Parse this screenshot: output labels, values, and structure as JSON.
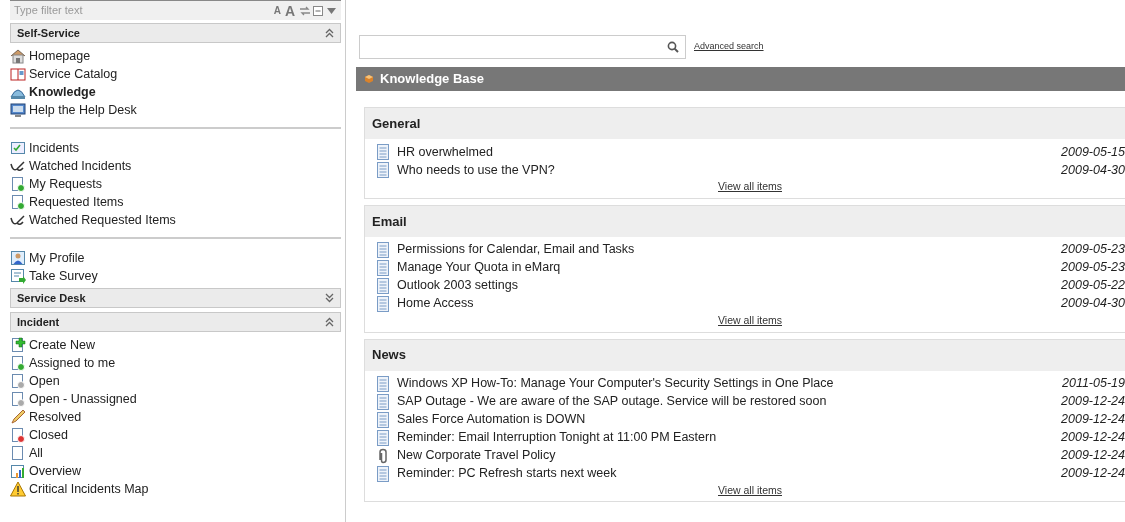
{
  "filter": {
    "placeholder": "Type filter text",
    "tools": [
      "A",
      "A"
    ]
  },
  "sections": [
    {
      "title": "Self-Service",
      "expanded": true,
      "groups": [
        [
          {
            "label": "Homepage",
            "selected": false
          },
          {
            "label": "Service Catalog",
            "selected": false
          },
          {
            "label": "Knowledge",
            "selected": true
          },
          {
            "label": "Help the Help Desk",
            "selected": false
          }
        ],
        [
          {
            "label": "Incidents",
            "selected": false
          },
          {
            "label": "Watched Incidents",
            "selected": false
          },
          {
            "label": "My Requests",
            "selected": false
          },
          {
            "label": "Requested Items",
            "selected": false
          },
          {
            "label": "Watched Requested Items",
            "selected": false
          }
        ],
        [
          {
            "label": "My Profile",
            "selected": false
          },
          {
            "label": "Take Survey",
            "selected": false
          }
        ]
      ]
    },
    {
      "title": "Service Desk",
      "expanded": false
    },
    {
      "title": "Incident",
      "expanded": true,
      "groups": [
        [
          {
            "label": "Create New",
            "selected": false
          },
          {
            "label": "Assigned to me",
            "selected": false
          },
          {
            "label": "Open",
            "selected": false
          },
          {
            "label": "Open - Unassigned",
            "selected": false
          },
          {
            "label": "Resolved",
            "selected": false
          },
          {
            "label": "Closed",
            "selected": false
          },
          {
            "label": "All",
            "selected": false
          },
          {
            "label": "Overview",
            "selected": false
          },
          {
            "label": "Critical Incidents Map",
            "selected": false
          }
        ]
      ]
    }
  ],
  "search": {
    "link": "Advanced search"
  },
  "knowledge_base": {
    "title": "Knowledge Base",
    "categories": [
      {
        "title": "General",
        "view_all": "View all items",
        "articles": [
          {
            "title": "HR overwhelmed",
            "date": "2009-05-15",
            "kind": "document"
          },
          {
            "title": "Who needs to use the VPN?",
            "date": "2009-04-30",
            "kind": "document"
          }
        ]
      },
      {
        "title": "Email",
        "view_all": "View all items",
        "articles": [
          {
            "title": "Permissions for Calendar, Email and Tasks",
            "date": "2009-05-23",
            "kind": "document"
          },
          {
            "title": "Manage Your Quota in eMarq",
            "date": "2009-05-23",
            "kind": "document"
          },
          {
            "title": "Outlook 2003 settings",
            "date": "2009-05-22",
            "kind": "document"
          },
          {
            "title": "Home Access",
            "date": "2009-04-30",
            "kind": "document"
          }
        ]
      },
      {
        "title": "News",
        "view_all": "View all items",
        "articles": [
          {
            "title": "Windows XP How-To: Manage Your Computer's Security Settings in One Place",
            "date": "2011-05-19",
            "kind": "document"
          },
          {
            "title": "SAP Outage - We are aware of the SAP outage. Service will be restored soon",
            "date": "2009-12-24",
            "kind": "document"
          },
          {
            "title": "Sales Force Automation is DOWN",
            "date": "2009-12-24",
            "kind": "document"
          },
          {
            "title": "Reminder: Email Interruption Tonight at 11:00 PM Eastern",
            "date": "2009-12-24",
            "kind": "document"
          },
          {
            "title": "New Corporate Travel Policy",
            "date": "2009-12-24",
            "kind": "attachment"
          },
          {
            "title": "Reminder: PC Refresh starts next week",
            "date": "2009-12-24",
            "kind": "document"
          }
        ]
      }
    ]
  }
}
